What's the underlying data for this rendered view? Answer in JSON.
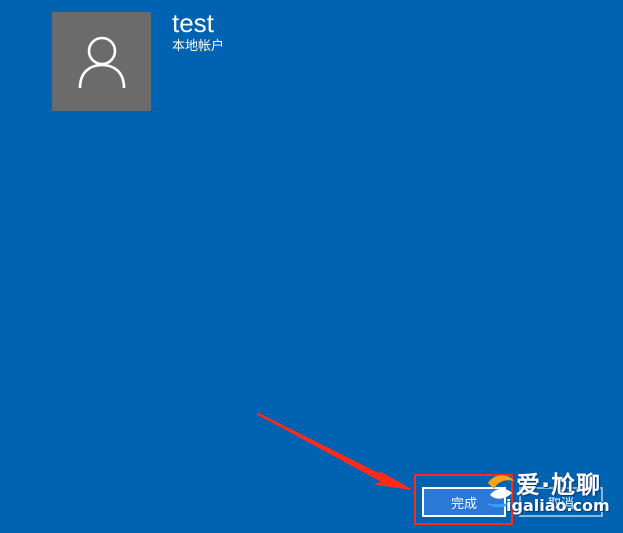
{
  "account": {
    "username": "test",
    "type": "本地帐户"
  },
  "icons": {
    "avatar": "user-icon"
  },
  "buttons": {
    "finish_label": "完成",
    "cancel_label": "取消"
  },
  "watermark": {
    "top": "爱·尬聊",
    "bottom": "igaliao.com"
  },
  "colors": {
    "background": "#0063b1",
    "avatar_bg": "#6b6b6b",
    "highlight": "#ff2a1a",
    "button_primary": "#2b78d6"
  }
}
